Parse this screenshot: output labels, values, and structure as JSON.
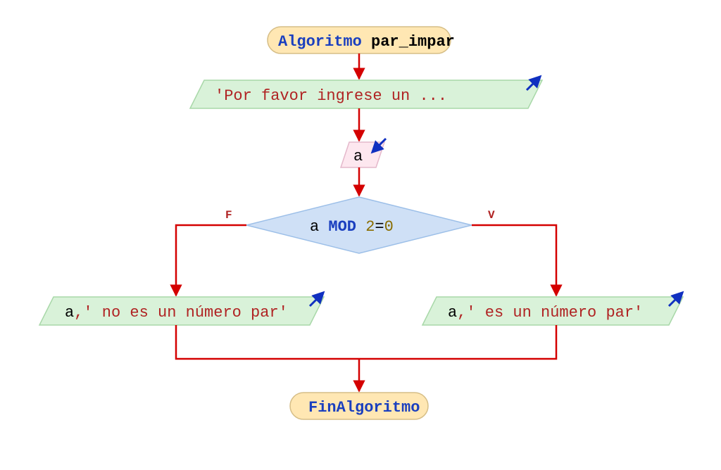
{
  "start": {
    "keyword": "Algoritmo",
    "name": " par_impar"
  },
  "output_prompt": {
    "text": "'Por favor ingrese un ..."
  },
  "input": {
    "var": "a"
  },
  "decision": {
    "var": "a ",
    "op": "MOD ",
    "rhs_num": "2",
    "eq": "=",
    "rhs_zero": "0",
    "true_label": "V",
    "false_label": "F"
  },
  "branch_false": {
    "var": "a",
    "comma": ",",
    "text": "' no es un número par'"
  },
  "branch_true": {
    "var": "a",
    "comma": ",",
    "text": "' es un número par'"
  },
  "end": {
    "keyword": "FinAlgoritmo"
  }
}
